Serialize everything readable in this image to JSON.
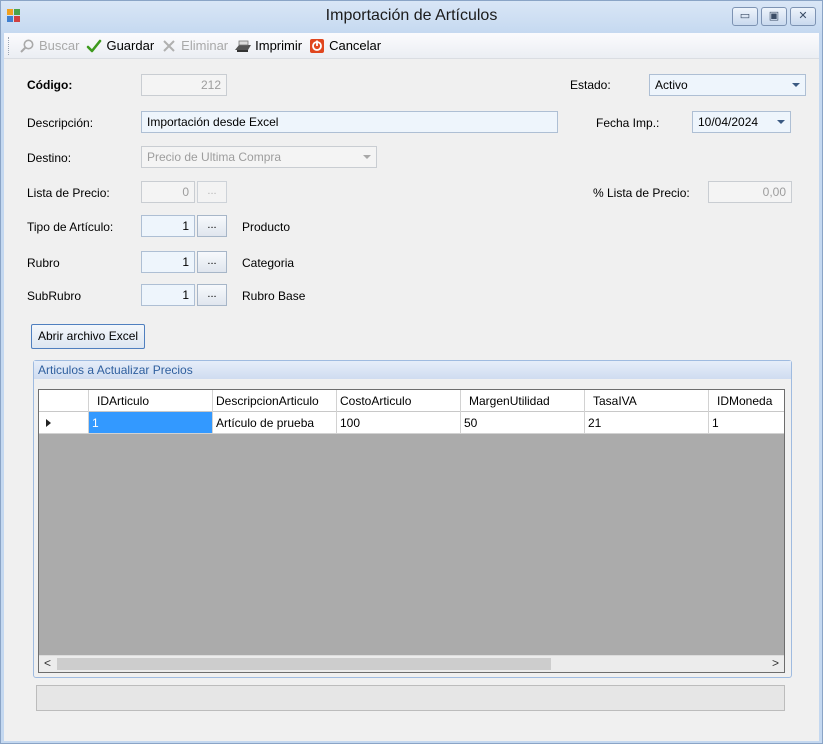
{
  "window": {
    "title": "Importación de Artículos"
  },
  "toolbar": {
    "buscar": "Buscar",
    "guardar": "Guardar",
    "eliminar": "Eliminar",
    "imprimir": "Imprimir",
    "cancelar": "Cancelar"
  },
  "form": {
    "codigo_label": "Código:",
    "codigo_value": "212",
    "estado_label": "Estado:",
    "estado_value": "Activo",
    "descripcion_label": "Descripción:",
    "descripcion_value": "Importación desde Excel",
    "fecha_label": "Fecha Imp.:",
    "fecha_value": "10/04/2024",
    "destino_label": "Destino:",
    "destino_value": "Precio de Ultima Compra",
    "lista_label": "Lista de Precio:",
    "lista_value": "0",
    "pct_lista_label": "% Lista de Precio:",
    "pct_lista_value": "0,00",
    "tipo_label": "Tipo de Artículo:",
    "tipo_value": "1",
    "tipo_desc": "Producto",
    "rubro_label": "Rubro",
    "rubro_value": "1",
    "rubro_desc": "Categoria",
    "subrubro_label": "SubRubro",
    "subrubro_value": "1",
    "subrubro_desc": "Rubro Base",
    "dots": "...",
    "abrir_excel": "Abrir archivo Excel"
  },
  "grid": {
    "group_title": "Articulos a Actualizar Precios",
    "columns": [
      "IDArticulo",
      "DescripcionArticulo",
      "CostoArticulo",
      "MargenUtilidad",
      "TasaIVA",
      "IDMoneda"
    ],
    "rows": [
      [
        "1",
        "Artículo de prueba",
        "100",
        "50",
        "21",
        "1"
      ]
    ],
    "scroll_left": "<",
    "scroll_right": ">"
  },
  "colors": {
    "selection": "#3399ff",
    "accent": "#2f5f9e",
    "grid_background": "#ababab"
  },
  "icons": {
    "buscar": "search-icon",
    "guardar": "checkmark-icon",
    "eliminar": "x-icon",
    "imprimir": "printer-icon",
    "cancelar": "cancel-icon"
  }
}
